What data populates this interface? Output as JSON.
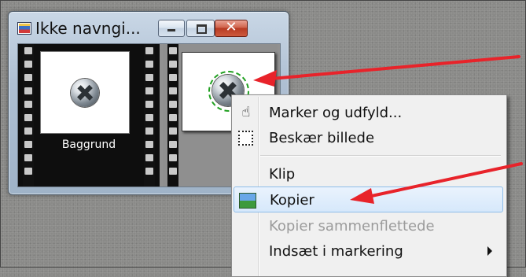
{
  "window": {
    "title": "Ikke navngi...",
    "controls": {
      "minimize": "minimize-icon",
      "maximize": "maximize-icon",
      "close": "close-icon"
    }
  },
  "layers": [
    {
      "label": "Baggrund",
      "thumbnail": "screw-image"
    },
    {
      "label": "",
      "thumbnail": "screw-image-selected"
    }
  ],
  "context_menu": {
    "items": [
      {
        "label": "Marker og udfyld...",
        "icon": "hand-fill-icon",
        "enabled": true
      },
      {
        "label": "Beskær billede",
        "icon": "crop-icon",
        "enabled": true
      },
      {
        "label": "Klip",
        "icon": "",
        "enabled": true
      },
      {
        "label": "Kopier",
        "icon": "image-icon",
        "enabled": true,
        "highlighted": true
      },
      {
        "label": "Kopier sammenflettede",
        "icon": "",
        "enabled": false
      },
      {
        "label": "Indsæt i markering",
        "icon": "",
        "enabled": true,
        "submenu": true
      }
    ]
  },
  "colors": {
    "annotation_arrow": "#e8232a",
    "menu_highlight": "#d6e8fb",
    "selection_marquee": "#20a020"
  }
}
